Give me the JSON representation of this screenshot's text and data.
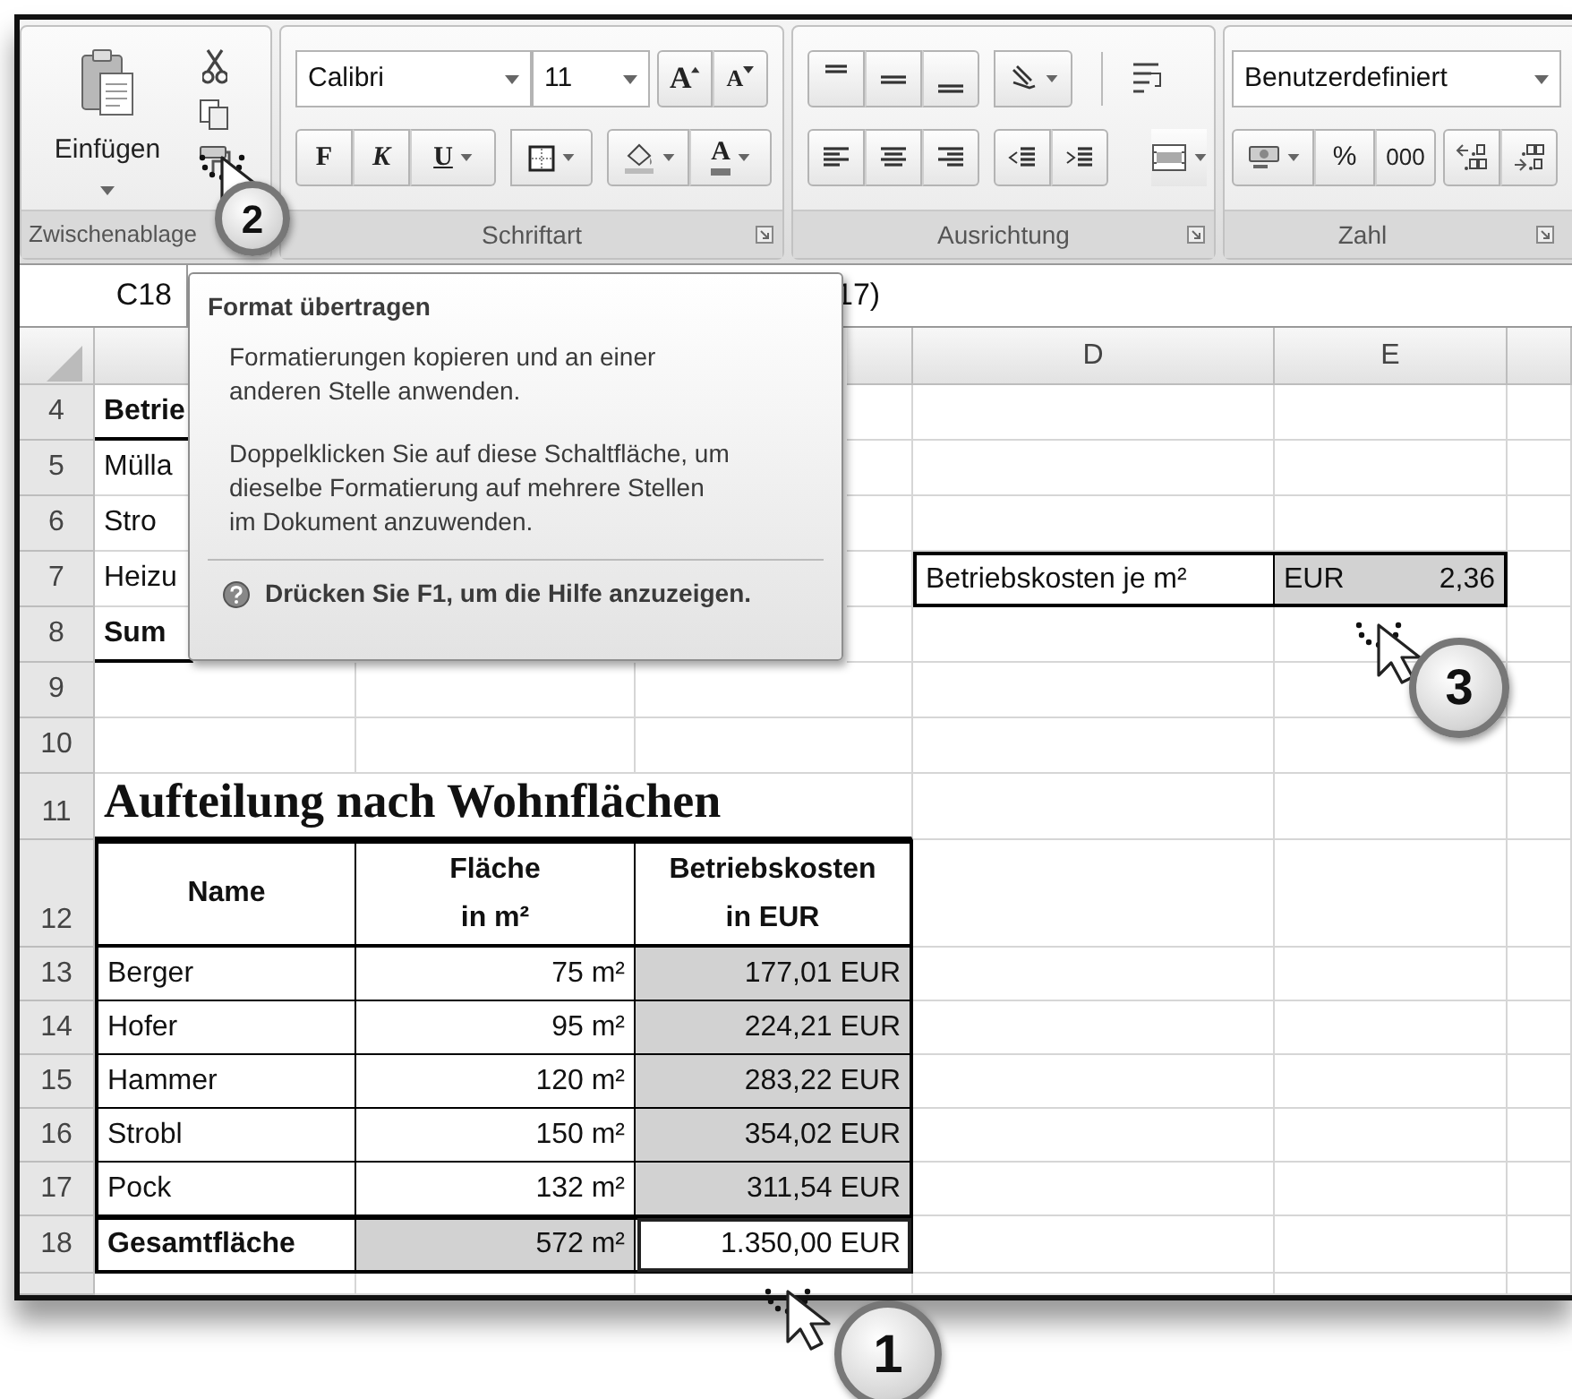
{
  "ribbon": {
    "clipboard": {
      "paste": "Einfügen",
      "label": "Zwischenablage"
    },
    "font": {
      "name": "Calibri",
      "size": "11",
      "grow": "A",
      "shrink": "A",
      "bold": "F",
      "italic": "K",
      "underline": "U",
      "font_color_letter": "A",
      "label": "Schriftart"
    },
    "alignment": {
      "label": "Ausrichtung"
    },
    "number": {
      "format": "Benutzerdefiniert",
      "percent": "%",
      "thousands": "000",
      "label": "Zahl"
    }
  },
  "formula_bar": {
    "name_box": "C18",
    "formula": "17)"
  },
  "sheet": {
    "columns": [
      {
        "label": "D"
      },
      {
        "label": "E"
      }
    ],
    "rows": [
      {
        "number": "4",
        "kind": "section_start",
        "label": "Betrie"
      },
      {
        "number": "5",
        "kind": "line",
        "label": "Mülla"
      },
      {
        "number": "6",
        "kind": "line",
        "label": "Stro"
      },
      {
        "number": "7",
        "kind": "line",
        "label": "Heizu",
        "rate": {
          "label": "Betriebskosten je m²",
          "currency": "EUR",
          "amount": "2,36"
        }
      },
      {
        "number": "8",
        "kind": "section_total",
        "label": "Sum"
      },
      {
        "number": "9",
        "kind": "blank"
      },
      {
        "number": "10",
        "kind": "blank"
      },
      {
        "number": "11",
        "kind": "title",
        "title": "Aufteilung nach Wohnflächen"
      },
      {
        "number": "12",
        "kind": "column_header",
        "cells": [
          {
            "lines": [
              "Name"
            ]
          },
          {
            "lines": [
              "Fläche",
              "in m²"
            ]
          },
          {
            "lines": [
              "Betriebskosten",
              "in EUR"
            ]
          }
        ]
      },
      {
        "number": "13",
        "kind": "entry",
        "cells": [
          {
            "text": "Berger",
            "shaded": false,
            "selected": false
          },
          {
            "text": "75 m²",
            "shaded": false,
            "selected": false
          },
          {
            "text": "177,01 EUR",
            "shaded": true,
            "selected": false
          }
        ]
      },
      {
        "number": "14",
        "kind": "entry",
        "cells": [
          {
            "text": "Hofer",
            "shaded": false,
            "selected": false
          },
          {
            "text": "95 m²",
            "shaded": false,
            "selected": false
          },
          {
            "text": "224,21 EUR",
            "shaded": true,
            "selected": false
          }
        ]
      },
      {
        "number": "15",
        "kind": "entry",
        "cells": [
          {
            "text": "Hammer",
            "shaded": false,
            "selected": false
          },
          {
            "text": "120 m²",
            "shaded": false,
            "selected": false
          },
          {
            "text": "283,22 EUR",
            "shaded": true,
            "selected": false
          }
        ]
      },
      {
        "number": "16",
        "kind": "entry",
        "cells": [
          {
            "text": "Strobl",
            "shaded": false,
            "selected": false
          },
          {
            "text": "150 m²",
            "shaded": false,
            "selected": false
          },
          {
            "text": "354,02 EUR",
            "shaded": true,
            "selected": false
          }
        ]
      },
      {
        "number": "17",
        "kind": "entry",
        "cells": [
          {
            "text": "Pock",
            "shaded": false,
            "selected": false
          },
          {
            "text": "132 m²",
            "shaded": false,
            "selected": false
          },
          {
            "text": "311,54 EUR",
            "shaded": true,
            "selected": false
          }
        ]
      },
      {
        "number": "18",
        "kind": "total",
        "cells": [
          {
            "text": "Gesamtfläche",
            "shaded": false,
            "selected": false
          },
          {
            "text": "572 m²",
            "shaded": true,
            "selected": false
          },
          {
            "text": "1.350,00 EUR",
            "shaded": false,
            "selected": true
          }
        ]
      }
    ]
  },
  "tooltip": {
    "title": "Format übertragen",
    "paragraphs": [
      "Formatierungen kopieren und an einer anderen Stelle anwenden.",
      "Doppelklicken Sie auf diese Schaltfläche, um dieselbe Formatierung auf mehrere Stellen im Dokument anzuwenden."
    ],
    "help": "Drücken Sie F1, um die Hilfe anzuzeigen."
  },
  "callouts": [
    {
      "number": "2"
    },
    {
      "number": "3"
    },
    {
      "number": "1"
    }
  ]
}
